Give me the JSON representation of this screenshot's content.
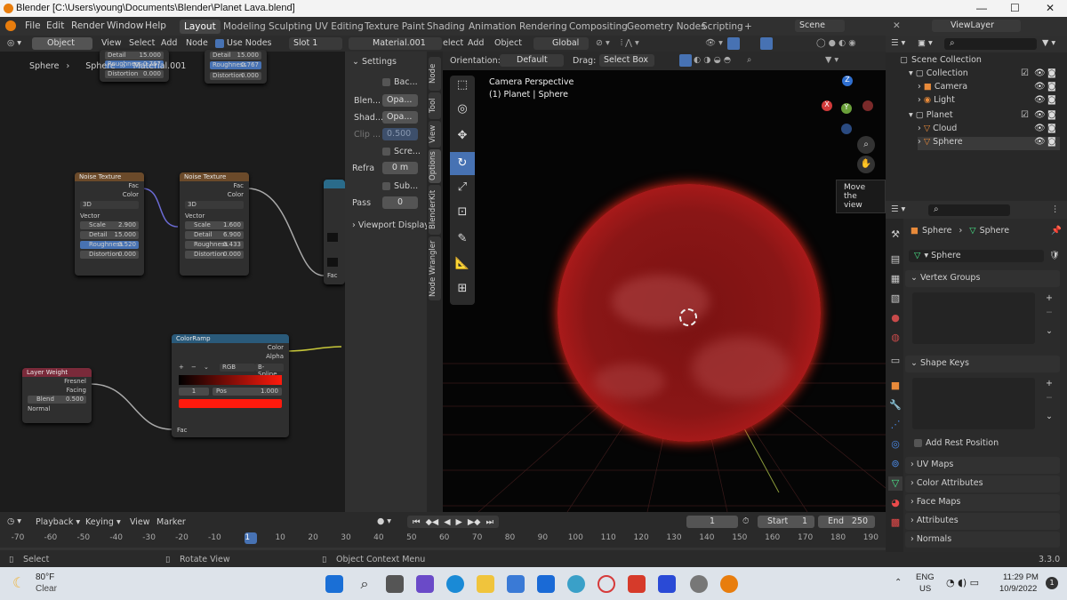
{
  "window": {
    "title": "Blender [C:\\Users\\young\\Documents\\Blender\\Planet Lava.blend]"
  },
  "menu": [
    "File",
    "Edit",
    "Render",
    "Window",
    "Help"
  ],
  "workspaces": [
    "Layout",
    "Modeling",
    "Sculpting",
    "UV Editing",
    "Texture Paint",
    "Shading",
    "Animation",
    "Rendering",
    "Compositing",
    "Geometry Nodes",
    "Scripting",
    "+"
  ],
  "scene": {
    "name": "Scene",
    "view_layer": "ViewLayer"
  },
  "node_editor": {
    "header": {
      "mode": "Object",
      "menus": [
        "View",
        "Select",
        "Add",
        "Node"
      ],
      "use_nodes": "Use Nodes",
      "slot": "Slot 1",
      "material": "Material.001"
    },
    "breadcrumb": [
      "Sphere",
      "Sphere",
      "Material.001"
    ],
    "nodes": {
      "top1": {
        "detail_label": "Detail",
        "detail": "15.000",
        "rough_label": "Roughness",
        "rough": "0.767",
        "dist_label": "Distortion",
        "dist": "0.000"
      },
      "top2": {
        "detail_label": "Detail",
        "detail": "15.000",
        "rough_label": "Roughness",
        "rough": "0.767",
        "dist_label": "Distortion",
        "dist": "0.000"
      },
      "noise1": {
        "title": "Noise Texture",
        "fac": "Fac",
        "color": "Color",
        "dim": "3D",
        "vector": "Vector",
        "scale_label": "Scale",
        "scale": "2.900",
        "detail_label": "Detail",
        "detail": "15.000",
        "rough_label": "Roughness",
        "rough": "0.520",
        "dist_label": "Distortion",
        "dist": "0.000"
      },
      "noise2": {
        "title": "Noise Texture",
        "fac": "Fac",
        "color": "Color",
        "dim": "3D",
        "vector": "Vector",
        "scale_label": "Scale",
        "scale": "1.600",
        "detail_label": "Detail",
        "detail": "6.900",
        "rough_label": "Roughness",
        "rough": "0.433",
        "dist_label": "Distortion",
        "dist": "0.000"
      },
      "colorramp": {
        "title": "ColorRamp",
        "color": "Color",
        "alpha": "Alpha",
        "mode": "RGB",
        "interp": "B-Spline",
        "index": "1",
        "pos_label": "Pos",
        "pos": "1.000",
        "fac": "Fac",
        "ramp_color": "#ff1a0d"
      },
      "layerweight": {
        "title": "Layer Weight",
        "fresnel": "Fresnel",
        "facing": "Facing",
        "blend_label": "Blend",
        "blend": "0.500",
        "normal": "Normal"
      },
      "partial_fac": "Fac"
    }
  },
  "settings_panel": {
    "title": "Settings",
    "backface": "Bac...",
    "blend_label": "Blen...",
    "blend_val": "Opa...",
    "shadow_label": "Shad...",
    "shadow_val": "Opa...",
    "clip_label": "Clip ...",
    "clip_val": "0.500",
    "screen": "Scre...",
    "refr_label": "Refra",
    "refr_val": "0 m",
    "sub": "Sub...",
    "pass_label": "Pass",
    "pass_val": "0",
    "viewport_display": "Viewport Display"
  },
  "side_tabs": [
    "Node",
    "Tool",
    "View",
    "Options",
    "BlenderKit",
    "Node Wrangler"
  ],
  "viewport": {
    "header_menus": [
      "elect",
      "Add",
      "Object"
    ],
    "transform": "Global",
    "orientation_label": "Orientation:",
    "orientation": "Default",
    "drag_label": "Drag:",
    "drag": "Select Box",
    "overlay_title": "Camera Perspective",
    "overlay_sub": "(1) Planet | Sphere",
    "tooltip": "Move the view",
    "gizmo": {
      "z": "Z",
      "y": "Y",
      "x": "X"
    }
  },
  "outliner": {
    "title": "Scene Collection",
    "items": [
      {
        "name": "Collection",
        "level": 1
      },
      {
        "name": "Camera",
        "level": 2
      },
      {
        "name": "Light",
        "level": 2
      },
      {
        "name": "Planet",
        "level": 1
      },
      {
        "name": "Cloud",
        "level": 2
      },
      {
        "name": "Sphere",
        "level": 2
      }
    ]
  },
  "properties": {
    "breadcrumb": [
      "Sphere",
      "Sphere"
    ],
    "mesh_name": "Sphere",
    "sections": [
      "Vertex Groups",
      "Shape Keys",
      "UV Maps",
      "Color Attributes",
      "Face Maps",
      "Attributes",
      "Normals"
    ],
    "add_rest_position": "Add Rest Position"
  },
  "timeline": {
    "menus": [
      "Playback",
      "Keying",
      "View",
      "Marker"
    ],
    "current": "1",
    "start_label": "Start",
    "start": "1",
    "end_label": "End",
    "end": "250",
    "ticks": [
      "-70",
      "-60",
      "-50",
      "-40",
      "-30",
      "-20",
      "-10",
      "1",
      "10",
      "20",
      "30",
      "40",
      "50",
      "60",
      "70",
      "80",
      "90",
      "100",
      "110",
      "120",
      "130",
      "140",
      "150",
      "160",
      "170",
      "180",
      "190"
    ]
  },
  "statusbar": {
    "select": "Select",
    "rotate": "Rotate View",
    "context": "Object Context Menu",
    "version": "3.3.0"
  },
  "taskbar": {
    "weather_temp": "80°F",
    "weather_desc": "Clear",
    "lang": "ENG",
    "region": "US",
    "time": "11:29 PM",
    "date": "10/9/2022",
    "notif": "1"
  }
}
